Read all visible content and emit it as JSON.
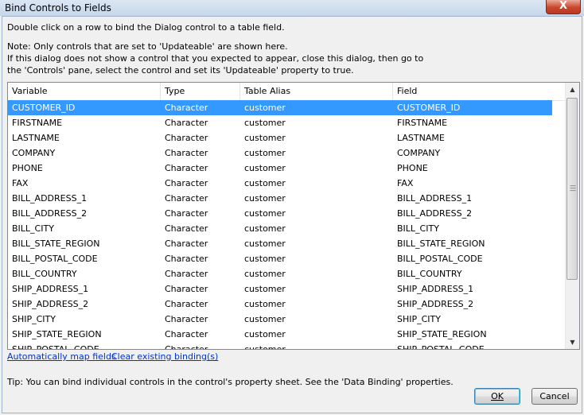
{
  "window": {
    "title": "Bind Controls to Fields",
    "close_label": "X"
  },
  "instructions": {
    "line1": "Double click on a row to bind the Dialog control to a table field.",
    "line2": "Note: Only controls that are set to 'Updateable' are shown here.",
    "line3": "If this dialog does not show a control that you expected to appear, close this dialog, then go to",
    "line4": "the 'Controls' pane, select the control and set its 'Updateable' property to true."
  },
  "table": {
    "columns": [
      "Variable",
      "Type",
      "Table Alias",
      "Field"
    ],
    "rows": [
      [
        "CUSTOMER_ID",
        "Character",
        "customer",
        "CUSTOMER_ID"
      ],
      [
        "FIRSTNAME",
        "Character",
        "customer",
        "FIRSTNAME"
      ],
      [
        "LASTNAME",
        "Character",
        "customer",
        "LASTNAME"
      ],
      [
        "COMPANY",
        "Character",
        "customer",
        "COMPANY"
      ],
      [
        "PHONE",
        "Character",
        "customer",
        "PHONE"
      ],
      [
        "FAX",
        "Character",
        "customer",
        "FAX"
      ],
      [
        "BILL_ADDRESS_1",
        "Character",
        "customer",
        "BILL_ADDRESS_1"
      ],
      [
        "BILL_ADDRESS_2",
        "Character",
        "customer",
        "BILL_ADDRESS_2"
      ],
      [
        "BILL_CITY",
        "Character",
        "customer",
        "BILL_CITY"
      ],
      [
        "BILL_STATE_REGION",
        "Character",
        "customer",
        "BILL_STATE_REGION"
      ],
      [
        "BILL_POSTAL_CODE",
        "Character",
        "customer",
        "BILL_POSTAL_CODE"
      ],
      [
        "BILL_COUNTRY",
        "Character",
        "customer",
        "BILL_COUNTRY"
      ],
      [
        "SHIP_ADDRESS_1",
        "Character",
        "customer",
        "SHIP_ADDRESS_1"
      ],
      [
        "SHIP_ADDRESS_2",
        "Character",
        "customer",
        "SHIP_ADDRESS_2"
      ],
      [
        "SHIP_CITY",
        "Character",
        "customer",
        "SHIP_CITY"
      ],
      [
        "SHIP_STATE_REGION",
        "Character",
        "customer",
        "SHIP_STATE_REGION"
      ],
      [
        "SHIP_POSTAL_CODE",
        "Character",
        "customer",
        "SHIP_POSTAL_CODE"
      ]
    ],
    "selected_row": 0,
    "selection_color": "#3399ff"
  },
  "links": {
    "auto_map": "Automatically map fields",
    "clear_bindings": "Clear existing binding(s)"
  },
  "tip": "Tip: You can bind individual controls in the control's property sheet. See the 'Data Binding' properties.",
  "buttons": {
    "ok": "OK",
    "cancel": "Cancel"
  },
  "scrollbar": {
    "up_icon": "arrow-up-icon",
    "down_icon": "arrow-down-icon",
    "grip_icon": "grip-icon"
  }
}
